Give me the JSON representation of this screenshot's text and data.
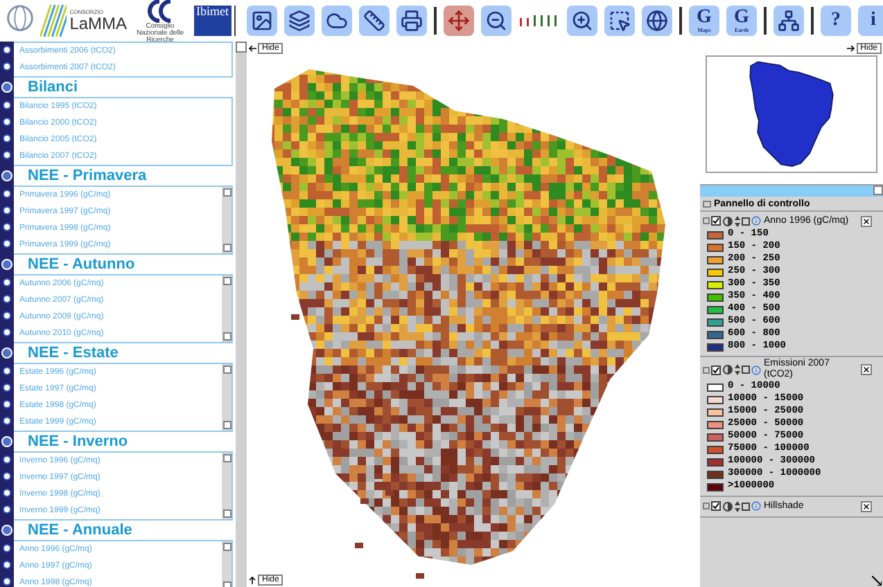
{
  "header": {
    "logo_small": "CONSORZIO",
    "logo_name": "LaMMA",
    "logo_ibimet": "Ibimet",
    "logo_cnr": "Consiglio Nazionale delle Ricerche"
  },
  "toolbar": [
    {
      "kind": "tool",
      "selected": false
    },
    {
      "kind": "tool",
      "selected": false
    },
    {
      "kind": "tool",
      "selected": false
    },
    {
      "kind": "tool",
      "selected": false
    },
    {
      "kind": "tool",
      "selected": false
    },
    {
      "kind": "separator"
    },
    {
      "kind": "tool",
      "selected": true
    },
    {
      "kind": "tool",
      "selected": false
    },
    {
      "kind": "scale"
    },
    {
      "kind": "tool",
      "selected": false
    },
    {
      "kind": "tool",
      "selected": false
    },
    {
      "kind": "tool",
      "selected": false
    },
    {
      "kind": "separator"
    },
    {
      "kind": "text",
      "label": "G",
      "sublabel": "Maps",
      "selected": false
    },
    {
      "kind": "text",
      "label": "G",
      "sublabel": "Earth",
      "selected": false
    },
    {
      "kind": "separator"
    },
    {
      "kind": "tool",
      "selected": false
    },
    {
      "kind": "separator"
    },
    {
      "kind": "text",
      "label": "?",
      "selected": false
    },
    {
      "kind": "text",
      "label": "i",
      "selected": false
    }
  ],
  "sections": [
    {
      "items": [
        {
          "label": "Assorbimenti 2006 (tCO2)",
          "selected": false
        },
        {
          "label": "Assorbimenti 2007 (tCO2)",
          "selected": false
        }
      ],
      "scrollbar": false
    },
    {
      "title": "Bilanci",
      "expanded": true,
      "items": [
        {
          "label": "Bilancio 1995 (tCO2)",
          "selected": false
        },
        {
          "label": "Bilancio 2000 (tCO2)",
          "selected": false
        },
        {
          "label": "Bilancio 2005 (tCO2)",
          "selected": false
        },
        {
          "label": "Bilancio 2007 (tCO2)",
          "selected": false
        }
      ],
      "scrollbar": false
    },
    {
      "title": "NEE - Primavera",
      "expanded": true,
      "items": [
        {
          "label": "Primavera 1996 (gC/mq)",
          "selected": false
        },
        {
          "label": "Primavera 1997 (gC/mq)",
          "selected": false
        },
        {
          "label": "Primavera 1998 (gC/mq)",
          "selected": false
        },
        {
          "label": "Primavera 1999 (gC/mq)",
          "selected": false
        }
      ],
      "scrollbar": true
    },
    {
      "title": "NEE - Autunno",
      "expanded": true,
      "items": [
        {
          "label": "Autunno 2006 (gC/mq)",
          "selected": false
        },
        {
          "label": "Autunno 2007 (gC/mq)",
          "selected": false
        },
        {
          "label": "Autunno 2009 (gC/mq)",
          "selected": false
        },
        {
          "label": "Autunno 2010 (gC/mq)",
          "selected": false
        }
      ],
      "scrollbar": true
    },
    {
      "title": "NEE - Estate",
      "expanded": true,
      "items": [
        {
          "label": "Estate 1996 (gC/mq)",
          "selected": false
        },
        {
          "label": "Estate 1997 (gC/mq)",
          "selected": false
        },
        {
          "label": "Estate 1998 (gC/mq)",
          "selected": false
        },
        {
          "label": "Estate 1999 (gC/mq)",
          "selected": false
        }
      ],
      "scrollbar": true
    },
    {
      "title": "NEE - Inverno",
      "expanded": true,
      "items": [
        {
          "label": "Inverno 1996 (gC/mq)",
          "selected": false
        },
        {
          "label": "Inverno 1997 (gC/mq)",
          "selected": false
        },
        {
          "label": "Inverno 1998 (gC/mq)",
          "selected": false
        },
        {
          "label": "Inverno 1999 (gC/mq)",
          "selected": false
        }
      ],
      "scrollbar": true
    },
    {
      "title": "NEE - Annuale",
      "expanded": true,
      "items": [
        {
          "label": "Anno 1996 (gC/mq)",
          "selected": false
        },
        {
          "label": "Anno 1997 (gC/mq)",
          "selected": false
        },
        {
          "label": "Anno 1998 (gC/mq)",
          "selected": false
        }
      ],
      "scrollbar": true
    }
  ],
  "map": {
    "hide_left": "Hide",
    "hide_bottom": "Hide",
    "hide_right": "Hide"
  },
  "control_panel": {
    "title": "Pannello di controllo",
    "layers": [
      {
        "name": "Anno 1996 (gC/mq)",
        "checked": true,
        "legend": [
          {
            "label": "0 - 150",
            "color": "#c4643c"
          },
          {
            "label": "150 - 200",
            "color": "#d8742c"
          },
          {
            "label": "200 - 250",
            "color": "#f0a030"
          },
          {
            "label": "250 - 300",
            "color": "#f8c800"
          },
          {
            "label": "300 - 350",
            "color": "#d8f000"
          },
          {
            "label": "350 - 400",
            "color": "#40c000"
          },
          {
            "label": "400 - 500",
            "color": "#20c040"
          },
          {
            "label": "500 - 600",
            "color": "#30a090"
          },
          {
            "label": "600 - 800",
            "color": "#306890"
          },
          {
            "label": "800 - 1000",
            "color": "#203080"
          }
        ]
      },
      {
        "name": "Emissioni 2007 (tCO2)",
        "checked": true,
        "legend": [
          {
            "label": "0 - 10000",
            "color": "#ffffff"
          },
          {
            "label": "10000 - 15000",
            "color": "#f8d8d0"
          },
          {
            "label": "15000 - 25000",
            "color": "#f8c0a0"
          },
          {
            "label": "25000 - 50000",
            "color": "#f09080"
          },
          {
            "label": "50000 - 75000",
            "color": "#d06060"
          },
          {
            "label": "75000 - 100000",
            "color": "#d05030"
          },
          {
            "label": "100000 - 300000",
            "color": "#a03030"
          },
          {
            "label": "300000 - 1000000",
            "color": "#703020"
          },
          {
            "label": ">1000000",
            "color": "#600000"
          }
        ]
      },
      {
        "name": "Hillshade",
        "checked": true
      }
    ]
  }
}
